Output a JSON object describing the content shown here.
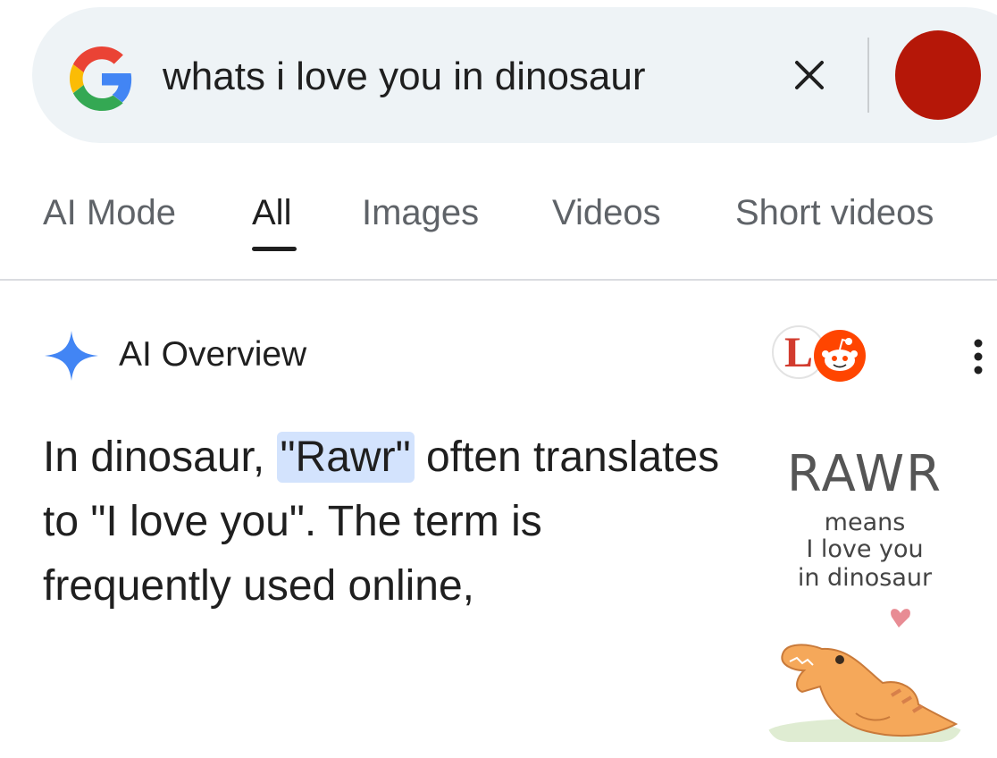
{
  "search": {
    "query": "whats i love you in dinosaur",
    "logo_icon": "google-g-icon",
    "clear_icon": "close-icon",
    "avatar_color": "#b51708"
  },
  "tabs": [
    {
      "label": "AI Mode",
      "active": false
    },
    {
      "label": "All",
      "active": true
    },
    {
      "label": "Images",
      "active": false
    },
    {
      "label": "Videos",
      "active": false
    },
    {
      "label": "Short videos",
      "active": false
    }
  ],
  "ai_overview": {
    "title": "AI Overview",
    "sparkle_icon": "gemini-sparkle-icon",
    "text_before": "In dinosaur, ",
    "highlight": "\"Rawr\"",
    "text_after": " often translates to \"I love you\". The term is frequently used online,",
    "source_icons": [
      "letter-l-source-icon",
      "reddit-icon"
    ],
    "source_letter": "L",
    "more_icon": "more-vert-icon"
  },
  "thumbnail": {
    "heading": "RAWR",
    "line1": "means",
    "line2": "I love you",
    "line3": "in dinosaur",
    "image_icon": "cartoon-dinosaur-heart-illustration"
  },
  "colors": {
    "search_bg": "#eef3f6",
    "highlight_bg": "#d3e3fd",
    "sparkle_blue": "#4285f4"
  }
}
